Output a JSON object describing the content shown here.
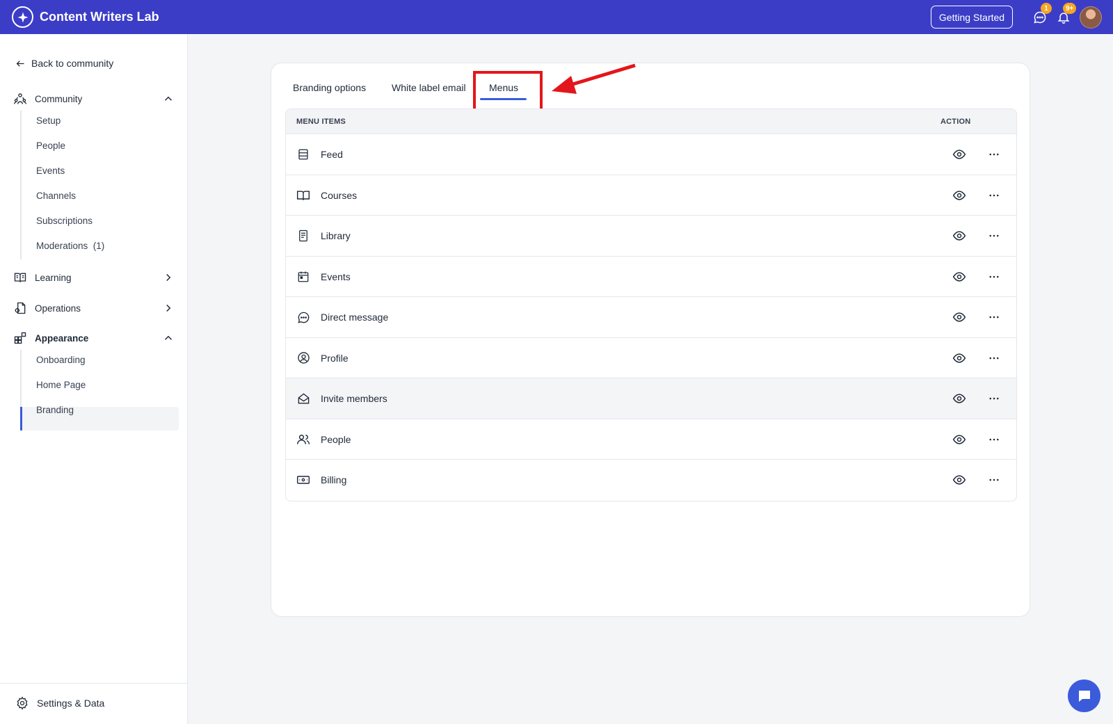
{
  "header": {
    "app_name": "Content Writers Lab",
    "getting_started_label": "Getting Started",
    "messages_badge": "1",
    "notifications_badge": "9+",
    "brand_color": "#3b3dc7",
    "badge_color": "#f5a623"
  },
  "sidebar": {
    "back_label": "Back to community",
    "sections": {
      "community": {
        "label": "Community",
        "icon": "community-icon",
        "expanded": true
      },
      "learning": {
        "label": "Learning",
        "icon": "book-open-icon",
        "expanded": false
      },
      "operations": {
        "label": "Operations",
        "icon": "operations-icon",
        "expanded": false
      },
      "appearance": {
        "label": "Appearance",
        "icon": "appearance-icon",
        "expanded": true
      }
    },
    "community_items": [
      "Setup",
      "People",
      "Events",
      "Channels",
      "Subscriptions",
      "Moderations  (1)"
    ],
    "appearance_items": [
      "Onboarding",
      "Home Page",
      "Branding"
    ],
    "active_item": "Branding",
    "settings_label": "Settings & Data",
    "accent_color": "#3b5bdb"
  },
  "main": {
    "tabs": [
      "Branding options",
      "White label email",
      "Menus"
    ],
    "active_tab": "Menus",
    "annotation_color": "#e3161b",
    "table": {
      "col_menu_items": "MENU ITEMS",
      "col_action": "ACTION",
      "rows": [
        {
          "label": "Feed",
          "icon": "feed-icon"
        },
        {
          "label": "Courses",
          "icon": "book-icon"
        },
        {
          "label": "Library",
          "icon": "library-icon"
        },
        {
          "label": "Events",
          "icon": "calendar-icon"
        },
        {
          "label": "Direct message",
          "icon": "chat-bubble-icon"
        },
        {
          "label": "Profile",
          "icon": "user-circle-icon"
        },
        {
          "label": "Invite members",
          "icon": "envelope-open-icon"
        },
        {
          "label": "People",
          "icon": "users-icon"
        },
        {
          "label": "Billing",
          "icon": "billing-icon"
        }
      ]
    }
  }
}
